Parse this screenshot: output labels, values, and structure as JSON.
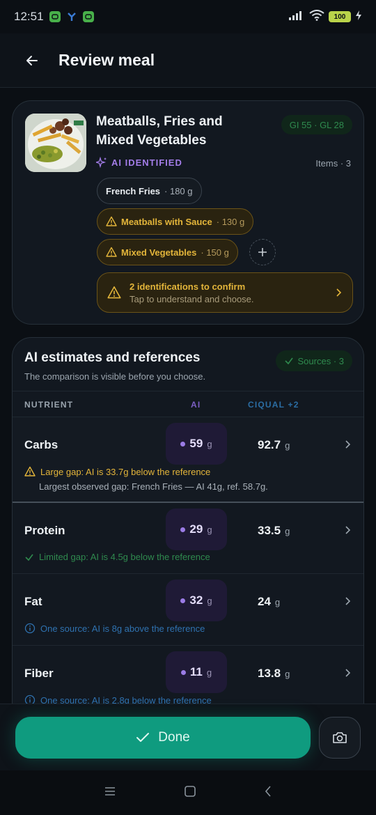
{
  "status": {
    "time": "12:51",
    "battery": "100"
  },
  "appbar": {
    "title": "Review meal"
  },
  "meal": {
    "title": "Meatballs, Fries and Mixed Vegetables",
    "gi_badge": "GI 55 · GL 28",
    "ai_label": "AI IDENTIFIED",
    "items_count": "Items · 3",
    "items": [
      {
        "name": "French Fries",
        "qty": "· 180 g",
        "status": "ok"
      },
      {
        "name": "Meatballs with Sauce",
        "qty": "· 130 g",
        "status": "warn"
      },
      {
        "name": "Mixed Vegetables",
        "qty": "· 150 g",
        "status": "warn"
      }
    ],
    "confirm": {
      "title": "2 identifications to confirm",
      "subtitle": "Tap to understand and choose."
    }
  },
  "estimates": {
    "title": "AI estimates and references",
    "subtitle": "The comparison is visible before you choose.",
    "sources_badge": "Sources · 3",
    "headers": {
      "nutrient": "NUTRIENT",
      "ai": "AI",
      "ref": "CIQUAL +2"
    },
    "rows": [
      {
        "name": "Carbs",
        "ai": "59",
        "ai_unit": "g",
        "ref": "92.7",
        "ref_unit": "g",
        "note": "Large gap: AI is 33.7g below the reference",
        "note2": "Largest observed gap: French Fries — AI 41g, ref. 58.7g."
      },
      {
        "name": "Protein",
        "ai": "29",
        "ai_unit": "g",
        "ref": "33.5",
        "ref_unit": "g",
        "note": "Limited gap: AI is 4.5g below the reference"
      },
      {
        "name": "Fat",
        "ai": "32",
        "ai_unit": "g",
        "ref": "24",
        "ref_unit": "g",
        "note": "One source: AI is 8g above the reference"
      },
      {
        "name": "Fiber",
        "ai": "11",
        "ai_unit": "g",
        "ref": "13.8",
        "ref_unit": "g",
        "note": "One source: AI is 2.8g below the reference"
      }
    ]
  },
  "actions": {
    "done": "Done"
  },
  "colors": {
    "accent": "#0f9b7f",
    "warn": "#e3b53a",
    "ai": "#9b7ce6",
    "ok": "#2f8a4e",
    "info": "#2f72b0"
  }
}
